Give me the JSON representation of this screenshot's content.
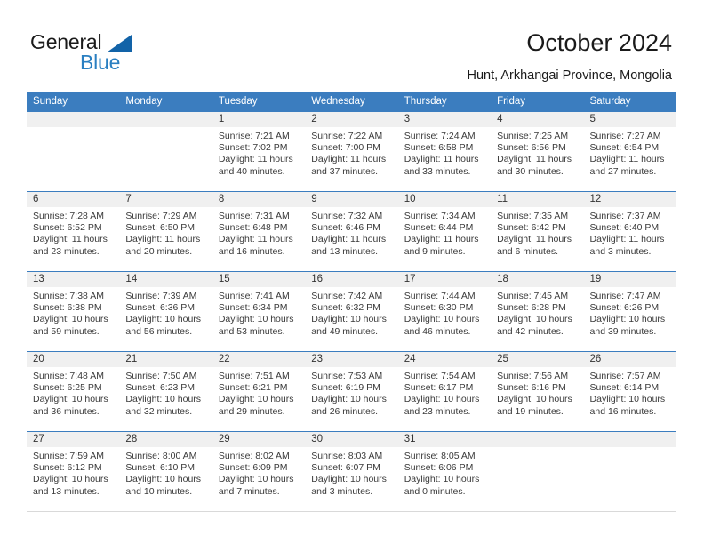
{
  "brand": {
    "word1": "General",
    "word2": "Blue",
    "logo_icon": "triangle-icon",
    "accent_color": "#2a7fc1",
    "triangle_color": "#1263a8"
  },
  "header": {
    "title": "October 2024",
    "subtitle": "Hunt, Arkhangai Province, Mongolia"
  },
  "calendar": {
    "header_color": "#3b7dbf",
    "daynum_band_color": "#f0f0f0",
    "weekdays": [
      "Sunday",
      "Monday",
      "Tuesday",
      "Wednesday",
      "Thursday",
      "Friday",
      "Saturday"
    ],
    "weeks": [
      [
        {
          "day": "",
          "sunrise": "",
          "sunset": "",
          "daylight": ""
        },
        {
          "day": "",
          "sunrise": "",
          "sunset": "",
          "daylight": ""
        },
        {
          "day": "1",
          "sunrise": "Sunrise: 7:21 AM",
          "sunset": "Sunset: 7:02 PM",
          "daylight": "Daylight: 11 hours and 40 minutes."
        },
        {
          "day": "2",
          "sunrise": "Sunrise: 7:22 AM",
          "sunset": "Sunset: 7:00 PM",
          "daylight": "Daylight: 11 hours and 37 minutes."
        },
        {
          "day": "3",
          "sunrise": "Sunrise: 7:24 AM",
          "sunset": "Sunset: 6:58 PM",
          "daylight": "Daylight: 11 hours and 33 minutes."
        },
        {
          "day": "4",
          "sunrise": "Sunrise: 7:25 AM",
          "sunset": "Sunset: 6:56 PM",
          "daylight": "Daylight: 11 hours and 30 minutes."
        },
        {
          "day": "5",
          "sunrise": "Sunrise: 7:27 AM",
          "sunset": "Sunset: 6:54 PM",
          "daylight": "Daylight: 11 hours and 27 minutes."
        }
      ],
      [
        {
          "day": "6",
          "sunrise": "Sunrise: 7:28 AM",
          "sunset": "Sunset: 6:52 PM",
          "daylight": "Daylight: 11 hours and 23 minutes."
        },
        {
          "day": "7",
          "sunrise": "Sunrise: 7:29 AM",
          "sunset": "Sunset: 6:50 PM",
          "daylight": "Daylight: 11 hours and 20 minutes."
        },
        {
          "day": "8",
          "sunrise": "Sunrise: 7:31 AM",
          "sunset": "Sunset: 6:48 PM",
          "daylight": "Daylight: 11 hours and 16 minutes."
        },
        {
          "day": "9",
          "sunrise": "Sunrise: 7:32 AM",
          "sunset": "Sunset: 6:46 PM",
          "daylight": "Daylight: 11 hours and 13 minutes."
        },
        {
          "day": "10",
          "sunrise": "Sunrise: 7:34 AM",
          "sunset": "Sunset: 6:44 PM",
          "daylight": "Daylight: 11 hours and 9 minutes."
        },
        {
          "day": "11",
          "sunrise": "Sunrise: 7:35 AM",
          "sunset": "Sunset: 6:42 PM",
          "daylight": "Daylight: 11 hours and 6 minutes."
        },
        {
          "day": "12",
          "sunrise": "Sunrise: 7:37 AM",
          "sunset": "Sunset: 6:40 PM",
          "daylight": "Daylight: 11 hours and 3 minutes."
        }
      ],
      [
        {
          "day": "13",
          "sunrise": "Sunrise: 7:38 AM",
          "sunset": "Sunset: 6:38 PM",
          "daylight": "Daylight: 10 hours and 59 minutes."
        },
        {
          "day": "14",
          "sunrise": "Sunrise: 7:39 AM",
          "sunset": "Sunset: 6:36 PM",
          "daylight": "Daylight: 10 hours and 56 minutes."
        },
        {
          "day": "15",
          "sunrise": "Sunrise: 7:41 AM",
          "sunset": "Sunset: 6:34 PM",
          "daylight": "Daylight: 10 hours and 53 minutes."
        },
        {
          "day": "16",
          "sunrise": "Sunrise: 7:42 AM",
          "sunset": "Sunset: 6:32 PM",
          "daylight": "Daylight: 10 hours and 49 minutes."
        },
        {
          "day": "17",
          "sunrise": "Sunrise: 7:44 AM",
          "sunset": "Sunset: 6:30 PM",
          "daylight": "Daylight: 10 hours and 46 minutes."
        },
        {
          "day": "18",
          "sunrise": "Sunrise: 7:45 AM",
          "sunset": "Sunset: 6:28 PM",
          "daylight": "Daylight: 10 hours and 42 minutes."
        },
        {
          "day": "19",
          "sunrise": "Sunrise: 7:47 AM",
          "sunset": "Sunset: 6:26 PM",
          "daylight": "Daylight: 10 hours and 39 minutes."
        }
      ],
      [
        {
          "day": "20",
          "sunrise": "Sunrise: 7:48 AM",
          "sunset": "Sunset: 6:25 PM",
          "daylight": "Daylight: 10 hours and 36 minutes."
        },
        {
          "day": "21",
          "sunrise": "Sunrise: 7:50 AM",
          "sunset": "Sunset: 6:23 PM",
          "daylight": "Daylight: 10 hours and 32 minutes."
        },
        {
          "day": "22",
          "sunrise": "Sunrise: 7:51 AM",
          "sunset": "Sunset: 6:21 PM",
          "daylight": "Daylight: 10 hours and 29 minutes."
        },
        {
          "day": "23",
          "sunrise": "Sunrise: 7:53 AM",
          "sunset": "Sunset: 6:19 PM",
          "daylight": "Daylight: 10 hours and 26 minutes."
        },
        {
          "day": "24",
          "sunrise": "Sunrise: 7:54 AM",
          "sunset": "Sunset: 6:17 PM",
          "daylight": "Daylight: 10 hours and 23 minutes."
        },
        {
          "day": "25",
          "sunrise": "Sunrise: 7:56 AM",
          "sunset": "Sunset: 6:16 PM",
          "daylight": "Daylight: 10 hours and 19 minutes."
        },
        {
          "day": "26",
          "sunrise": "Sunrise: 7:57 AM",
          "sunset": "Sunset: 6:14 PM",
          "daylight": "Daylight: 10 hours and 16 minutes."
        }
      ],
      [
        {
          "day": "27",
          "sunrise": "Sunrise: 7:59 AM",
          "sunset": "Sunset: 6:12 PM",
          "daylight": "Daylight: 10 hours and 13 minutes."
        },
        {
          "day": "28",
          "sunrise": "Sunrise: 8:00 AM",
          "sunset": "Sunset: 6:10 PM",
          "daylight": "Daylight: 10 hours and 10 minutes."
        },
        {
          "day": "29",
          "sunrise": "Sunrise: 8:02 AM",
          "sunset": "Sunset: 6:09 PM",
          "daylight": "Daylight: 10 hours and 7 minutes."
        },
        {
          "day": "30",
          "sunrise": "Sunrise: 8:03 AM",
          "sunset": "Sunset: 6:07 PM",
          "daylight": "Daylight: 10 hours and 3 minutes."
        },
        {
          "day": "31",
          "sunrise": "Sunrise: 8:05 AM",
          "sunset": "Sunset: 6:06 PM",
          "daylight": "Daylight: 10 hours and 0 minutes."
        },
        {
          "day": "",
          "sunrise": "",
          "sunset": "",
          "daylight": ""
        },
        {
          "day": "",
          "sunrise": "",
          "sunset": "",
          "daylight": ""
        }
      ]
    ]
  }
}
